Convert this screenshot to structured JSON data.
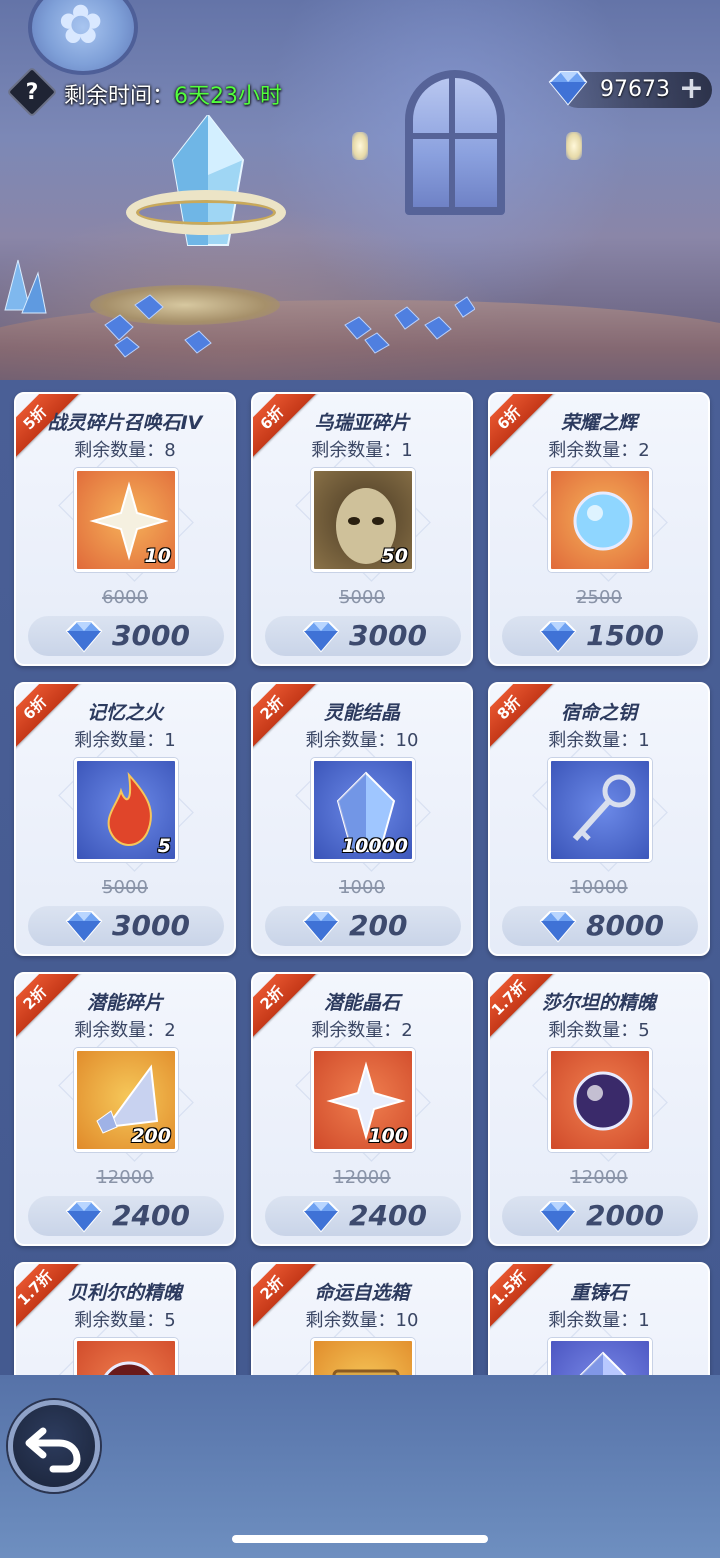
{
  "hud": {
    "timer_label": "剩余时间：",
    "timer_value": "6天23小时",
    "currency_value": "97673",
    "help_icon": "question-icon",
    "add_icon": "plus-icon"
  },
  "colors": {
    "timer_value": "#52ff3d",
    "ribbon": "#d9431f",
    "card_bg": "#eef2fb",
    "price_text": "#3d4a6e"
  },
  "shop": {
    "remain_prefix": "剩余数量：",
    "items": [
      {
        "discount": "5折",
        "name": "战灵碎片召唤石IV",
        "remain": "剩余数量：8",
        "qty": "10",
        "old_price": "6000",
        "price": "3000",
        "icon": "summon-stone-icon"
      },
      {
        "discount": "6折",
        "name": "乌瑞亚碎片",
        "remain": "剩余数量：1",
        "qty": "50",
        "old_price": "5000",
        "price": "3000",
        "icon": "hero-shard-icon"
      },
      {
        "discount": "6折",
        "name": "荣耀之辉",
        "remain": "剩余数量：2",
        "qty": "",
        "old_price": "2500",
        "price": "1500",
        "icon": "glory-orb-icon"
      },
      {
        "discount": "6折",
        "name": "记忆之火",
        "remain": "剩余数量：1",
        "qty": "5",
        "old_price": "5000",
        "price": "3000",
        "icon": "memory-flame-icon"
      },
      {
        "discount": "2折",
        "name": "灵能结晶",
        "remain": "剩余数量：10",
        "qty": "10000",
        "old_price": "1000",
        "price": "200",
        "icon": "psionic-crystal-icon"
      },
      {
        "discount": "8折",
        "name": "宿命之钥",
        "remain": "剩余数量：1",
        "qty": "",
        "old_price": "10000",
        "price": "8000",
        "icon": "fate-key-icon"
      },
      {
        "discount": "2折",
        "name": "潜能碎片",
        "remain": "剩余数量：2",
        "qty": "200",
        "old_price": "12000",
        "price": "2400",
        "icon": "potential-shard-icon"
      },
      {
        "discount": "2折",
        "name": "潜能晶石",
        "remain": "剩余数量：2",
        "qty": "100",
        "old_price": "12000",
        "price": "2400",
        "icon": "potential-spar-icon"
      },
      {
        "discount": "1.7折",
        "name": "莎尔坦的精魄",
        "remain": "剩余数量：5",
        "qty": "",
        "old_price": "12000",
        "price": "2000",
        "icon": "dark-soul-orb-icon"
      },
      {
        "discount": "1.7折",
        "name": "贝利尔的精魄",
        "remain": "剩余数量：5",
        "qty": "",
        "old_price": "",
        "price": "",
        "icon": "red-soul-orb-icon"
      },
      {
        "discount": "2折",
        "name": "命运自选箱",
        "remain": "剩余数量：10",
        "qty": "",
        "old_price": "",
        "price": "",
        "icon": "fate-chest-icon"
      },
      {
        "discount": "1.5折",
        "name": "重铸石",
        "remain": "剩余数量：1",
        "qty": "",
        "old_price": "",
        "price": "",
        "icon": "reforge-stone-icon"
      }
    ]
  },
  "nav": {
    "back_icon": "back-arrow-icon"
  }
}
